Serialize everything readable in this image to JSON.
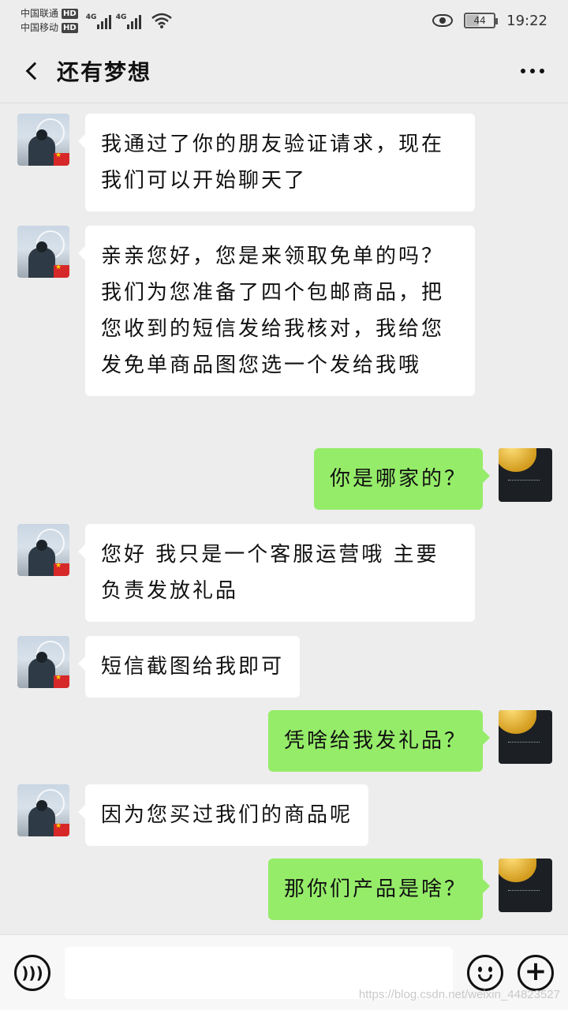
{
  "status_bar": {
    "carrier_1": "中国联通",
    "carrier_2": "中国移动",
    "hd_label": "HD",
    "network_1": "4G",
    "network_2": "4G",
    "battery": "44",
    "time": "19:22"
  },
  "header": {
    "title": "还有梦想",
    "icons": [
      "back-icon",
      "more-icon"
    ]
  },
  "messages": [
    {
      "side": "left",
      "text": "我通过了你的朋友验证请求，现在我们可以开始聊天了"
    },
    {
      "side": "left",
      "text": "亲亲您好，您是来领取免单的吗？我们为您准备了四个包邮商品，把您收到的短信发给我核对，我给您发免单商品图您选一个发给我哦"
    },
    {
      "side": "right",
      "text": "你是哪家的？"
    },
    {
      "side": "left",
      "text": "您好 我只是一个客服运营哦 主要负责发放礼品"
    },
    {
      "side": "left",
      "text": "短信截图给我即可"
    },
    {
      "side": "right",
      "text": "凭啥给我发礼品？"
    },
    {
      "side": "left",
      "text": "因为您买过我们的商品呢"
    },
    {
      "side": "right",
      "text": "那你们产品是啥？"
    }
  ],
  "input_bar": {
    "value": "",
    "icons": [
      "voice-icon",
      "emoji-icon",
      "plus-icon"
    ]
  },
  "watermark": "https://blog.csdn.net/weixin_44823527",
  "colors": {
    "background": "#ededed",
    "bubble_received": "#ffffff",
    "bubble_sent": "#95ec69",
    "input_bar": "#f7f7f7"
  }
}
